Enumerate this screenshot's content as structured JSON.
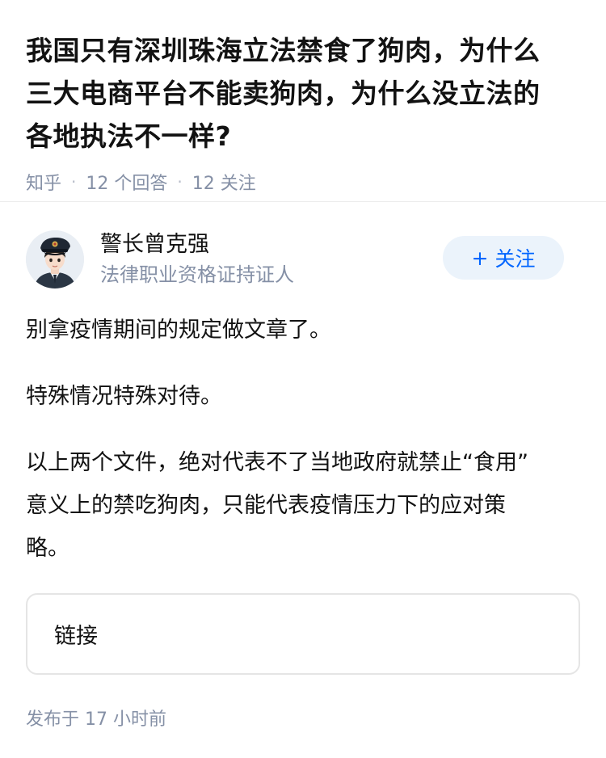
{
  "question": {
    "title_lines": [
      "我国只有深圳珠海立法禁食了狗肉，为什么",
      "三大电商平台不能卖狗肉，为什么没立法的",
      "各地执法不一样?"
    ],
    "source": "知乎",
    "answers_count": "12",
    "answers_label": "个回答",
    "followers_count": "12",
    "followers_label": "关注"
  },
  "answer": {
    "author": {
      "name": "警长曾克强",
      "description": "法律职业资格证持证人",
      "avatar_icon": "police-officer-avatar"
    },
    "follow_button": {
      "plus": "+",
      "label": "关注"
    },
    "paragraphs": [
      [
        "别拿疫情期间的规定做文章了。"
      ],
      [
        "特殊情况特殊对待。"
      ],
      [
        "以上两个文件，绝对代表不了当地政府就禁止“食用”",
        "意义上的禁吃狗肉，只能代表疫情压力下的应对策",
        "略。"
      ]
    ],
    "link_card_label": "链接",
    "published_label": "发布于",
    "published_time": "17 小时前"
  },
  "colors": {
    "accent": "#0066ff",
    "follow_bg": "#ebf3fb",
    "meta_gray": "#8590a6"
  }
}
